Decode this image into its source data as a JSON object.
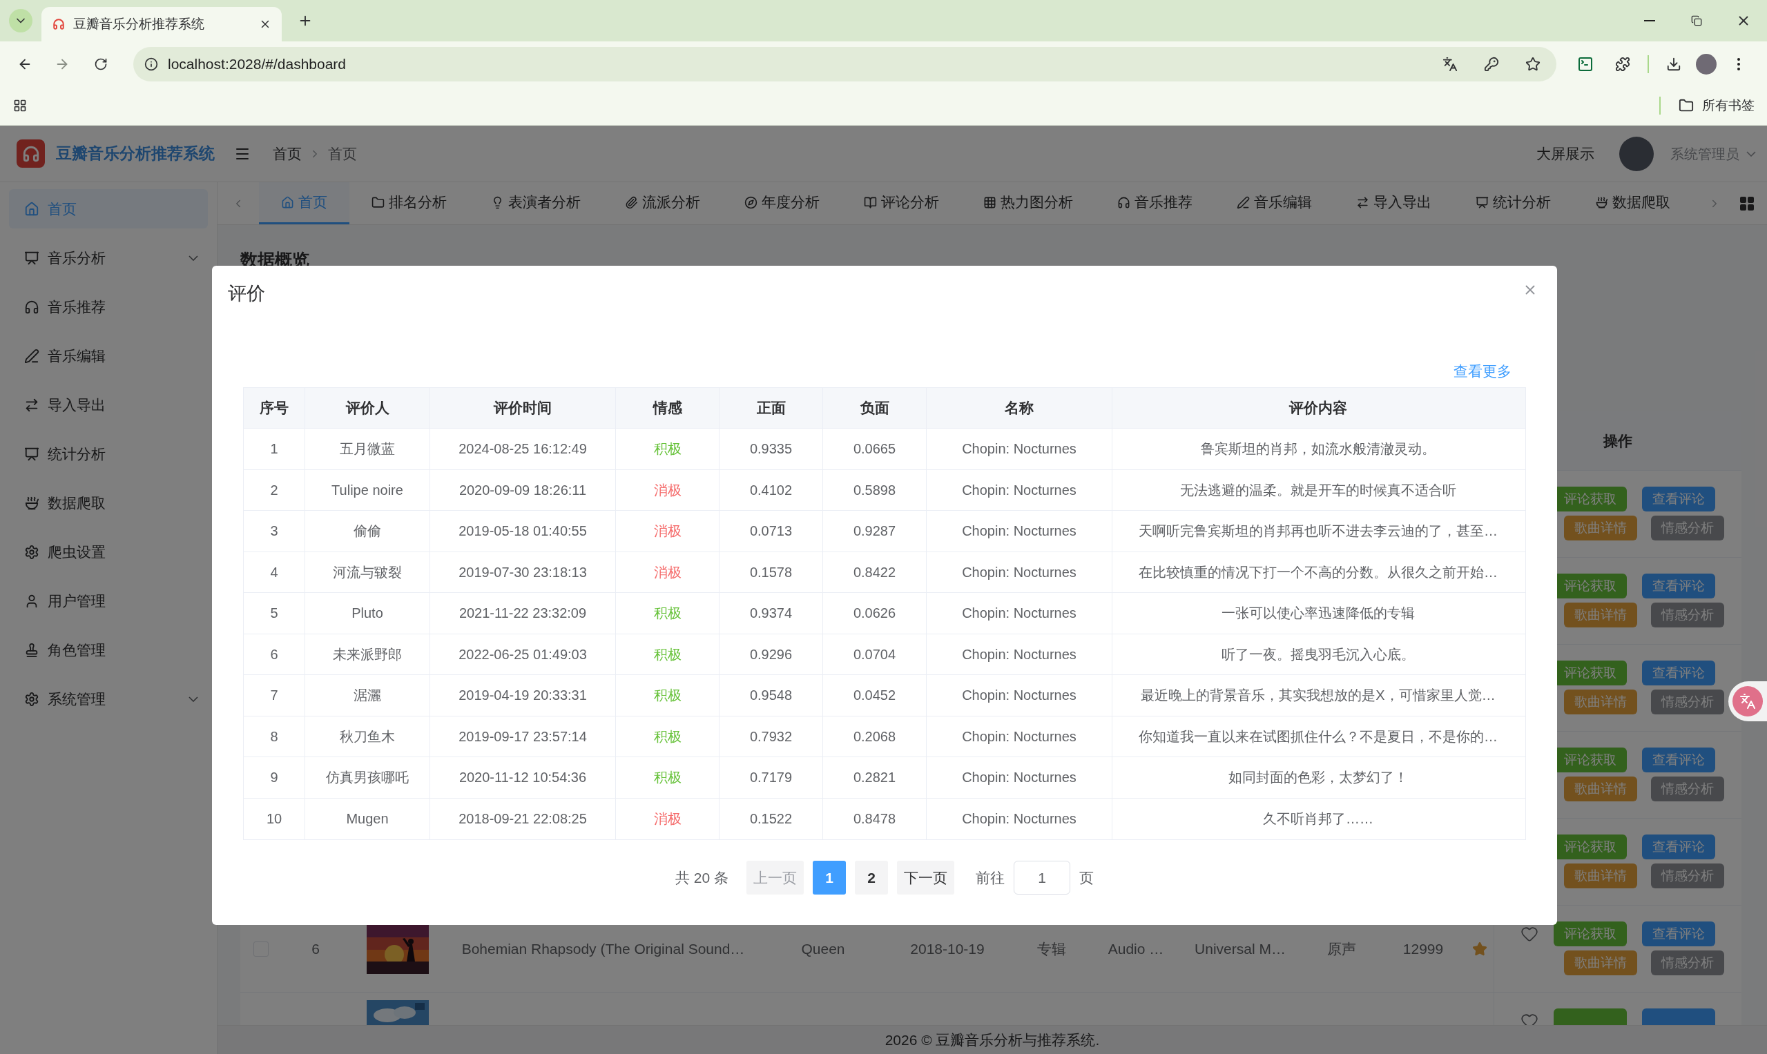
{
  "browser": {
    "tab_title": "豆瓣音乐分析推荐系统",
    "url": "localhost:2028/#/dashboard",
    "bookmarks_label": "所有书签"
  },
  "header": {
    "title": "豆瓣音乐分析推荐系统",
    "breadcrumb": [
      "首页",
      "首页"
    ],
    "screen_link": "大屏展示",
    "user": "系统管理员"
  },
  "sidebar": {
    "items": [
      {
        "label": "首页",
        "selected": true,
        "submenu": false
      },
      {
        "label": "音乐分析",
        "selected": false,
        "submenu": true
      },
      {
        "label": "音乐推荐",
        "selected": false,
        "submenu": false
      },
      {
        "label": "音乐编辑",
        "selected": false,
        "submenu": false
      },
      {
        "label": "导入导出",
        "selected": false,
        "submenu": false
      },
      {
        "label": "统计分析",
        "selected": false,
        "submenu": false
      },
      {
        "label": "数据爬取",
        "selected": false,
        "submenu": false
      },
      {
        "label": "爬虫设置",
        "selected": false,
        "submenu": false
      },
      {
        "label": "用户管理",
        "selected": false,
        "submenu": false
      },
      {
        "label": "角色管理",
        "selected": false,
        "submenu": false
      },
      {
        "label": "系统管理",
        "selected": false,
        "submenu": true
      }
    ]
  },
  "tabs": [
    {
      "label": "首页",
      "selected": true
    },
    {
      "label": "排名分析",
      "selected": false
    },
    {
      "label": "表演者分析",
      "selected": false
    },
    {
      "label": "流派分析",
      "selected": false
    },
    {
      "label": "年度分析",
      "selected": false
    },
    {
      "label": "评论分析",
      "selected": false
    },
    {
      "label": "热力图分析",
      "selected": false
    },
    {
      "label": "音乐推荐",
      "selected": false
    },
    {
      "label": "音乐编辑",
      "selected": false
    },
    {
      "label": "导入导出",
      "selected": false
    },
    {
      "label": "统计分析",
      "selected": false
    },
    {
      "label": "数据爬取",
      "selected": false
    }
  ],
  "page": {
    "title": "数据概览",
    "actions_header": "操作",
    "rows": [
      {
        "actions": [
          {
            "label": "评论获取",
            "kind": "success"
          },
          {
            "label": "查看评论",
            "kind": "primary"
          },
          {
            "label": "歌曲详情",
            "kind": "warning"
          },
          {
            "label": "情感分析",
            "kind": "info"
          }
        ]
      },
      {
        "actions": [
          {
            "label": "评论获取",
            "kind": "success"
          },
          {
            "label": "查看评论",
            "kind": "primary"
          },
          {
            "label": "歌曲详情",
            "kind": "warning"
          },
          {
            "label": "情感分析",
            "kind": "info"
          }
        ]
      },
      {
        "actions": [
          {
            "label": "评论获取",
            "kind": "success"
          },
          {
            "label": "查看评论",
            "kind": "primary"
          },
          {
            "label": "歌曲详情",
            "kind": "warning"
          },
          {
            "label": "情感分析",
            "kind": "info"
          }
        ]
      },
      {
        "actions": [
          {
            "label": "评论获取",
            "kind": "success"
          },
          {
            "label": "查看评论",
            "kind": "primary"
          },
          {
            "label": "歌曲详情",
            "kind": "warning"
          },
          {
            "label": "情感分析",
            "kind": "info"
          }
        ]
      },
      {
        "actions": [
          {
            "label": "评论获取",
            "kind": "success"
          },
          {
            "label": "查看评论",
            "kind": "primary"
          },
          {
            "label": "歌曲详情",
            "kind": "warning"
          },
          {
            "label": "情感分析",
            "kind": "info"
          }
        ]
      },
      {
        "checked": false,
        "index": "6",
        "cells": [
          "Bohemian Rhapsody (The Original Sound…",
          "Queen",
          "2018-10-19",
          "专辑",
          "Audio …",
          "Universal M…",
          "原声",
          "12999"
        ],
        "favorite": false,
        "actions": [
          {
            "label": "评论获取",
            "kind": "success"
          },
          {
            "label": "查看评论",
            "kind": "primary"
          },
          {
            "label": "歌曲详情",
            "kind": "warning"
          },
          {
            "label": "情感分析",
            "kind": "info"
          }
        ]
      },
      {
        "favorite": false,
        "actions": [
          {
            "kind": "success"
          },
          {
            "kind": "primary"
          }
        ]
      }
    ]
  },
  "footer": "2026 © 豆瓣音乐分析与推荐系统.",
  "dialog": {
    "title": "评价",
    "more_link": "查看更多",
    "columns": [
      "序号",
      "评价人",
      "评价时间",
      "情感",
      "正面",
      "负面",
      "名称",
      "评价内容"
    ],
    "rows": [
      {
        "index": "1",
        "reviewer": "五月微蓝",
        "time": "2024-08-25 16:12:49",
        "sentiment": "积极",
        "color": "#67c23a",
        "positive": "0.9335",
        "negative": "0.0665",
        "name": "Chopin: Nocturnes",
        "content": "鲁宾斯坦的肖邦，如流水般清澈灵动。"
      },
      {
        "index": "2",
        "reviewer": "Tulipe noire",
        "time": "2020-09-09 18:26:11",
        "sentiment": "消极",
        "color": "#f56c6c",
        "positive": "0.4102",
        "negative": "0.5898",
        "name": "Chopin: Nocturnes",
        "content": "无法逃避的温柔。就是开车的时候真不适合听"
      },
      {
        "index": "3",
        "reviewer": "偷偷",
        "time": "2019-05-18 01:40:55",
        "sentiment": "消极",
        "color": "#f56c6c",
        "positive": "0.0713",
        "negative": "0.9287",
        "name": "Chopin: Nocturnes",
        "content": "天啊听完鲁宾斯坦的肖邦再也听不进去李云迪的了，甚至…"
      },
      {
        "index": "4",
        "reviewer": "河流与皲裂",
        "time": "2019-07-30 23:18:13",
        "sentiment": "消极",
        "color": "#f56c6c",
        "positive": "0.1578",
        "negative": "0.8422",
        "name": "Chopin: Nocturnes",
        "content": "在比较慎重的情况下打一个不高的分数。从很久之前开始…"
      },
      {
        "index": "5",
        "reviewer": "Pluto",
        "time": "2021-11-22 23:32:09",
        "sentiment": "积极",
        "color": "#67c23a",
        "positive": "0.9374",
        "negative": "0.0626",
        "name": "Chopin: Nocturnes",
        "content": "一张可以使心率迅速降低的专辑"
      },
      {
        "index": "6",
        "reviewer": "未来派野郎",
        "time": "2022-06-25 01:49:03",
        "sentiment": "积极",
        "color": "#67c23a",
        "positive": "0.9296",
        "negative": "0.0704",
        "name": "Chopin: Nocturnes",
        "content": "听了一夜。摇曳羽毛沉入心底。"
      },
      {
        "index": "7",
        "reviewer": "涺灑",
        "time": "2019-04-19 20:33:31",
        "sentiment": "积极",
        "color": "#67c23a",
        "positive": "0.9548",
        "negative": "0.0452",
        "name": "Chopin: Nocturnes",
        "content": "最近晚上的背景音乐，其实我想放的是X，可惜家里人觉…"
      },
      {
        "index": "8",
        "reviewer": "秋刀鱼木",
        "time": "2019-09-17 23:57:14",
        "sentiment": "积极",
        "color": "#67c23a",
        "positive": "0.7932",
        "negative": "0.2068",
        "name": "Chopin: Nocturnes",
        "content": "你知道我一直以来在试图抓住什么？不是夏日，不是你的…"
      },
      {
        "index": "9",
        "reviewer": "仿真男孩哪吒",
        "time": "2020-11-12 10:54:36",
        "sentiment": "积极",
        "color": "#67c23a",
        "positive": "0.7179",
        "negative": "0.2821",
        "name": "Chopin: Nocturnes",
        "content": "如同封面的色彩，太梦幻了！"
      },
      {
        "index": "10",
        "reviewer": "Mugen",
        "time": "2018-09-21 22:08:25",
        "sentiment": "消极",
        "color": "#f56c6c",
        "positive": "0.1522",
        "negative": "0.8478",
        "name": "Chopin: Nocturnes",
        "content": "久不听肖邦了……"
      }
    ],
    "pagination": {
      "total": "共 20 条",
      "prev": {
        "label": "上一页",
        "disabled": true
      },
      "pages": [
        {
          "label": "1",
          "selected": true
        },
        {
          "label": "2",
          "selected": false
        }
      ],
      "next": {
        "label": "下一页",
        "disabled": false
      },
      "goto": "前往",
      "page_input": "1",
      "page_suffix": "页"
    }
  }
}
